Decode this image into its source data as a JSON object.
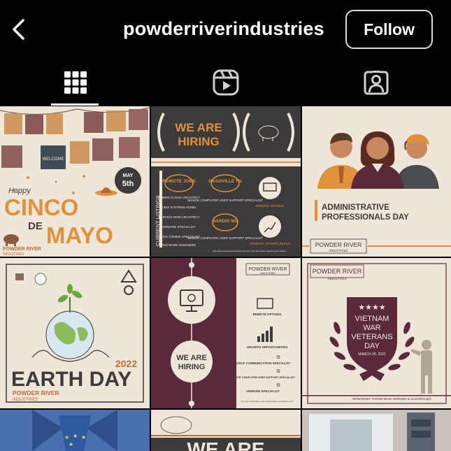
{
  "header": {
    "username": "powderriverindustries",
    "follow_label": "Follow"
  },
  "tabs": [
    {
      "name": "posts",
      "icon": "grid-icon"
    },
    {
      "name": "reels",
      "icon": "reels-icon"
    },
    {
      "name": "tagged",
      "icon": "tagged-person-icon"
    }
  ],
  "posts": {
    "p1": {
      "date_month": "MAY",
      "date_day": "5th",
      "happy": "Happy",
      "line1": "CINCO",
      "line2": "DE",
      "line3": "MAYO",
      "brand": "POWDER RIVER",
      "brand_sub": "INDUSTRIES",
      "banner": "WELCOME"
    },
    "p2": {
      "title1": "WE ARE",
      "title2": "HIRING",
      "side": "CURRENT LISTINGS",
      "bubble1": "REMOTE JOBS",
      "bubble2": "NASHVILLE TN",
      "bubble3": "SARDIS MS",
      "list1": [
        "HYBRID CLOUD ARCHITECT",
        "UNIX SYSTEMS ADMIN",
        "SERVICE NOW ARCHITECT",
        "VMWARE SPECIALIST",
        "VOICE COMMS SPECIALIST",
        "NETWORK ENGINEER"
      ],
      "list2": [
        "SENIOR COMPUTER USER SUPPORT SPECIALIST",
        "SENIOR COMPUTER USER SUPPORT SPECIALIST"
      ],
      "label1": "REMOTE OPTIONS",
      "label2": "GROWTH OPPORTUNITIES",
      "footer": "Visit www.powderriverindustries.com for more information regarding job listings"
    },
    "p3": {
      "line1": "ADMINISTRATIVE",
      "line2": "PROFESSIONALS DAY",
      "brand": "POWDER RIVER",
      "brand_sub": "INDUSTRIES"
    },
    "p4": {
      "year": "2022",
      "title": "EARTH DAY",
      "brand": "POWDER RIVER",
      "brand_sub": "INDUSTRIES"
    },
    "p5": {
      "brand": "POWDER RIVER",
      "brand_sub": "INDUSTRIES",
      "title1": "WE ARE",
      "title2": "HIRING",
      "opt1": "REMOTE OPTIONS",
      "opt2": "GROWTH OPPORTUNITIES",
      "job1": "VOICE COMMUNICATION SPECIALIST",
      "job2": "SENIOR COMPUTER USER SUPPORT SPECIALIST",
      "job3": "VMWARE SPECIALIST",
      "footer": "For more information, visit www.powderriverindustries.com"
    },
    "p6": {
      "brand": "POWDER RIVER",
      "brand_sub": "INDUSTRIES",
      "line1": "VIETNAM",
      "line2": "WAR",
      "line3": "VETERANS",
      "line4": "DAY",
      "date": "MARCH 29, 2022",
      "footer": "HONORING THOSE WHO SERVED & SACRIFICED"
    },
    "p8": {
      "title": "WE ARE"
    }
  },
  "colors": {
    "orange": "#e0913a",
    "cream": "#efe6da",
    "maroon": "#5a2a3c",
    "dark": "#3c3a3a",
    "rust": "#c66a2d"
  }
}
